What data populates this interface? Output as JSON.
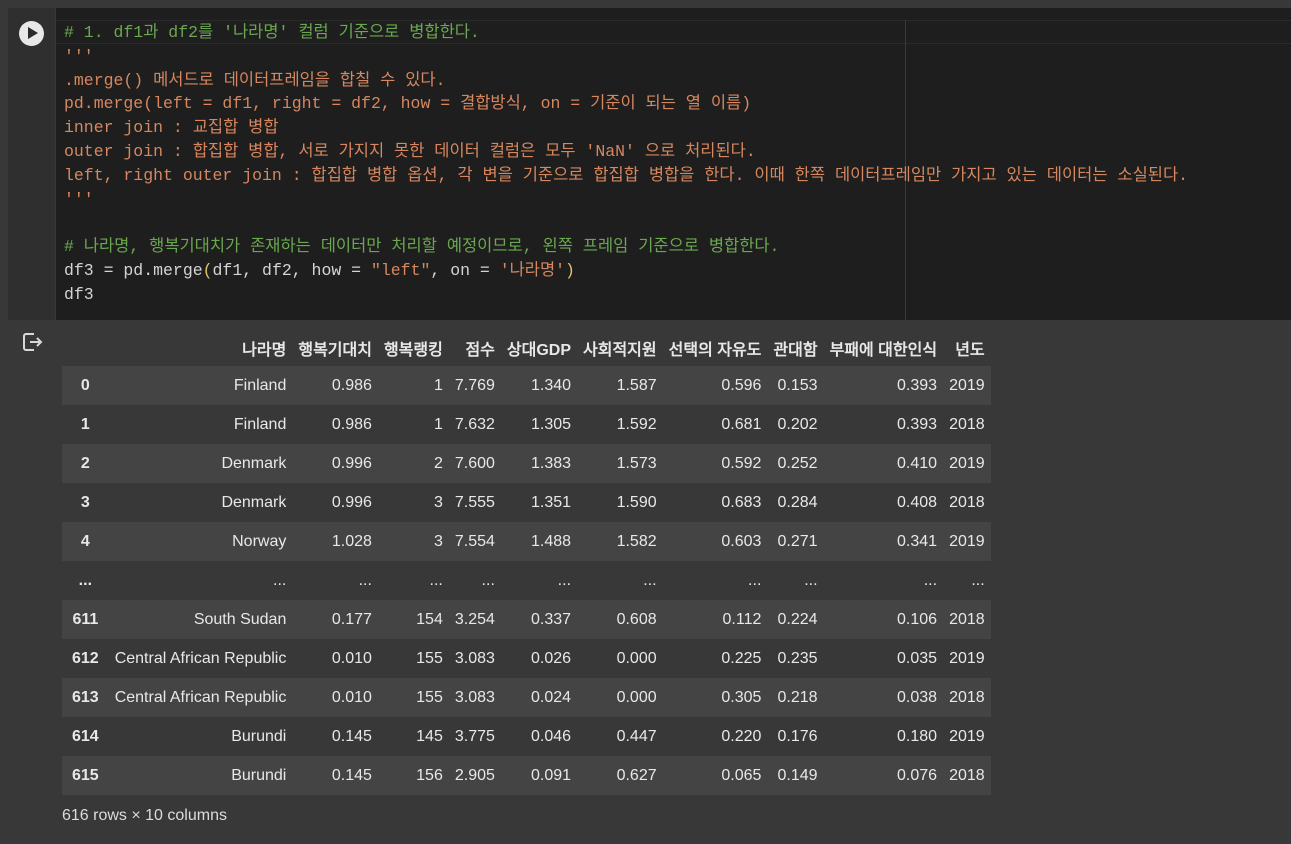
{
  "code_lines": [
    [
      {
        "t": "# 1. df1과 df2를 '나라명' 컬럼 기준으로 병합한다.",
        "c": "com"
      }
    ],
    [
      {
        "t": "'''",
        "c": "str"
      }
    ],
    [
      {
        "t": ".merge() 메서드로 데이터프레임을 합칠 수 있다.",
        "c": "str"
      }
    ],
    [
      {
        "t": "pd.merge(left = df1, right = df2, how = 결합방식, on = 기준이 되는 열 이름)",
        "c": "str"
      }
    ],
    [
      {
        "t": "inner join : 교집합 병합",
        "c": "str"
      }
    ],
    [
      {
        "t": "outer join : 합집합 병합, 서로 가지지 못한 데이터 컬럼은 모두 'NaN' 으로 처리된다.",
        "c": "str"
      }
    ],
    [
      {
        "t": "left, right outer join : 합집합 병합 옵션, 각 변을 기준으로 합집합 병합을 한다. 이때 한쪽 데이터프레임만 가지고 있는 데이터는 소실된다.",
        "c": "str"
      }
    ],
    [
      {
        "t": "'''",
        "c": "str"
      }
    ],
    [
      {
        "t": "",
        "c": "def"
      }
    ],
    [
      {
        "t": "# 나라명, 행복기대치가 존재하는 데이터만 처리할 예정이므로, 왼쪽 프레임 기준으로 병합한다.",
        "c": "com"
      }
    ],
    [
      {
        "t": "df3 = pd.merge",
        "c": "def"
      },
      {
        "t": "(",
        "c": "par"
      },
      {
        "t": "df1, df2, how = ",
        "c": "def"
      },
      {
        "t": "\"left\"",
        "c": "str"
      },
      {
        "t": ", on = ",
        "c": "def"
      },
      {
        "t": "'나라명'",
        "c": "str"
      },
      {
        "t": ")",
        "c": "par"
      }
    ],
    [
      {
        "t": "df3",
        "c": "def"
      }
    ]
  ],
  "table": {
    "columns": [
      "",
      "나라명",
      "행복기대치",
      "행복랭킹",
      "점수",
      "상대GDP",
      "사회적지원",
      "선택의 자유도",
      "관대함",
      "부패에 대한인식",
      "년도"
    ],
    "rows": [
      [
        "0",
        "Finland",
        "0.986",
        "1",
        "7.769",
        "1.340",
        "1.587",
        "0.596",
        "0.153",
        "0.393",
        "2019"
      ],
      [
        "1",
        "Finland",
        "0.986",
        "1",
        "7.632",
        "1.305",
        "1.592",
        "0.681",
        "0.202",
        "0.393",
        "2018"
      ],
      [
        "2",
        "Denmark",
        "0.996",
        "2",
        "7.600",
        "1.383",
        "1.573",
        "0.592",
        "0.252",
        "0.410",
        "2019"
      ],
      [
        "3",
        "Denmark",
        "0.996",
        "3",
        "7.555",
        "1.351",
        "1.590",
        "0.683",
        "0.284",
        "0.408",
        "2018"
      ],
      [
        "4",
        "Norway",
        "1.028",
        "3",
        "7.554",
        "1.488",
        "1.582",
        "0.603",
        "0.271",
        "0.341",
        "2019"
      ],
      [
        "...",
        "...",
        "...",
        "...",
        "...",
        "...",
        "...",
        "...",
        "...",
        "...",
        "..."
      ],
      [
        "611",
        "South Sudan",
        "0.177",
        "154",
        "3.254",
        "0.337",
        "0.608",
        "0.112",
        "0.224",
        "0.106",
        "2018"
      ],
      [
        "612",
        "Central African Republic",
        "0.010",
        "155",
        "3.083",
        "0.026",
        "0.000",
        "0.225",
        "0.235",
        "0.035",
        "2019"
      ],
      [
        "613",
        "Central African Republic",
        "0.010",
        "155",
        "3.083",
        "0.024",
        "0.000",
        "0.305",
        "0.218",
        "0.038",
        "2018"
      ],
      [
        "614",
        "Burundi",
        "0.145",
        "145",
        "3.775",
        "0.046",
        "0.447",
        "0.220",
        "0.176",
        "0.180",
        "2019"
      ],
      [
        "615",
        "Burundi",
        "0.145",
        "156",
        "2.905",
        "0.091",
        "0.627",
        "0.065",
        "0.149",
        "0.076",
        "2018"
      ]
    ]
  },
  "footer": "616 rows × 10 columns",
  "icons": {
    "run": "play-icon",
    "output": "output-exit-icon"
  }
}
